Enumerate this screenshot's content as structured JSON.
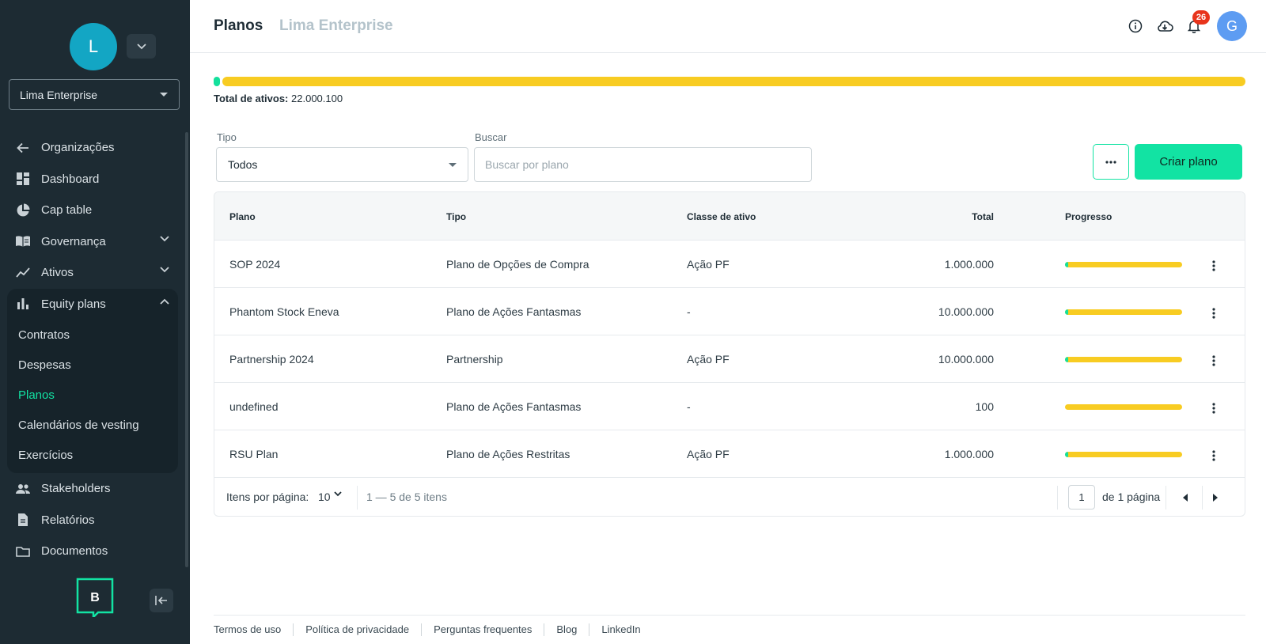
{
  "sidebar": {
    "org_avatar_initial": "L",
    "org_select_value": "Lima Enterprise",
    "nav": [
      {
        "label": "Organizações",
        "icon": "arrow-left-icon"
      },
      {
        "label": "Dashboard",
        "icon": "dashboard-icon"
      },
      {
        "label": "Cap table",
        "icon": "pie-chart-icon"
      },
      {
        "label": "Governança",
        "icon": "book-icon"
      },
      {
        "label": "Ativos",
        "icon": "trend-line-icon"
      }
    ],
    "equity": {
      "label": "Equity plans",
      "icon": "bar-chart-icon",
      "items": [
        {
          "label": "Contratos"
        },
        {
          "label": "Despesas"
        },
        {
          "label": "Planos"
        },
        {
          "label": "Calendários de vesting"
        },
        {
          "label": "Exercícios"
        }
      ]
    },
    "nav_bottom": [
      {
        "label": "Stakeholders",
        "icon": "people-icon"
      },
      {
        "label": "Relatórios",
        "icon": "document-icon"
      },
      {
        "label": "Documentos",
        "icon": "folder-icon"
      }
    ],
    "brand_letter": "B"
  },
  "header": {
    "title": "Planos",
    "subtitle": "Lima Enterprise",
    "notification_count": "26",
    "user_initial": "G"
  },
  "summary": {
    "total_label": "Total de ativos:",
    "total_value": "22.000.100",
    "progress_fraction": 0.005
  },
  "filters": {
    "type_label": "Tipo",
    "type_value": "Todos",
    "search_label": "Buscar",
    "search_placeholder": "Buscar por plano",
    "more_label": "...",
    "create_label": "Criar plano"
  },
  "table": {
    "headers": [
      "Plano",
      "Tipo",
      "Classe de ativo",
      "Total",
      "Progresso"
    ],
    "rows": [
      {
        "plan": "SOP 2024",
        "type": "Plano de Opções de Compra",
        "asset_class": "Ação PF",
        "total": "1.000.000",
        "progress": 0.03
      },
      {
        "plan": "Phantom Stock Eneva",
        "type": "Plano de Ações Fantasmas",
        "asset_class": "-",
        "total": "10.000.000",
        "progress": 0.03
      },
      {
        "plan": "Partnership 2024",
        "type": "Partnership",
        "asset_class": "Ação PF",
        "total": "10.000.000",
        "progress": 0.03
      },
      {
        "plan": "undefined",
        "type": "Plano de Ações Fantasmas",
        "asset_class": "-",
        "total": "100",
        "progress": 0
      },
      {
        "plan": "RSU Plan",
        "type": "Plano de Ações Restritas",
        "asset_class": "Ação PF",
        "total": "1.000.000",
        "progress": 0.03
      }
    ]
  },
  "pagination": {
    "per_page_label": "Itens por página:",
    "per_page_value": "10",
    "range_text": "1 — 5 de 5 itens",
    "current_page": "1",
    "page_of": "de 1 página"
  },
  "footer": {
    "links": [
      "Termos de uso",
      "Política de privacidade",
      "Perguntas frequentes",
      "Blog",
      "LinkedIn"
    ]
  },
  "colors": {
    "sidebar_bg": "#1d2b33",
    "accent": "#12e3a3",
    "progress_yellow": "#f8cc22",
    "badge_red": "#e8341c"
  }
}
